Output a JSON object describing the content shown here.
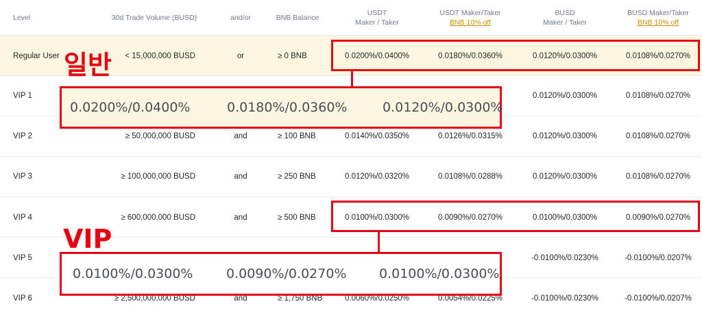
{
  "header": {
    "level": "Level",
    "volume": "30d Trade Volume (BUSD)",
    "andor": "and/or",
    "bnb": "BNB Balance",
    "usdt_line1": "USDT",
    "usdt_line2": "Maker / Taker",
    "usdt_disc_line1": "USDT Maker/Taker",
    "usdt_disc_line2": "BNB 10% off",
    "busd_line1": "BUSD",
    "busd_line2": "Maker / Taker",
    "busd_disc_line1": "BUSD Maker/Taker",
    "busd_disc_line2": "BNB 10% off"
  },
  "rows": [
    {
      "level": "Regular User",
      "volume": "< 15,000,000 BUSD",
      "andor": "or",
      "bnb": "≥ 0 BNB",
      "usdt": "0.0200%/0.0400%",
      "usdt_disc": "0.0180%/0.0360%",
      "busd": "0.0120%/0.0300%",
      "busd_disc": "0.0108%/0.0270%"
    },
    {
      "level": "VIP 1",
      "volume": "",
      "andor": "",
      "bnb": "",
      "usdt": "",
      "usdt_disc": "",
      "busd": "0.0120%/0.0300%",
      "busd_disc": "0.0108%/0.0270%"
    },
    {
      "level": "VIP 2",
      "volume": "≥ 50,000,000 BUSD",
      "andor": "and",
      "bnb": "≥ 100 BNB",
      "usdt": "0.0140%/0.0350%",
      "usdt_disc": "0.0126%/0.0315%",
      "busd": "0.0120%/0.0300%",
      "busd_disc": "0.0108%/0.0270%"
    },
    {
      "level": "VIP 3",
      "volume": "≥ 100,000,000 BUSD",
      "andor": "and",
      "bnb": "≥ 250 BNB",
      "usdt": "0.0120%/0.0320%",
      "usdt_disc": "0.0108%/0.0288%",
      "busd": "0.0120%/0.0300%",
      "busd_disc": "0.0108%/0.0270%"
    },
    {
      "level": "VIP 4",
      "volume": "≥ 600,000,000 BUSD",
      "andor": "and",
      "bnb": "≥ 500 BNB",
      "usdt": "0.0100%/0.0300%",
      "usdt_disc": "0.0090%/0.0270%",
      "busd": "0.0100%/0.0300%",
      "busd_disc": "0.0090%/0.0270%"
    },
    {
      "level": "VIP 5",
      "volume": "",
      "andor": "",
      "bnb": "",
      "usdt": "",
      "usdt_disc": "",
      "busd": "-0.0100%/0.0230%",
      "busd_disc": "-0.0100%/0.0207%"
    },
    {
      "level": "VIP 6",
      "volume": "≥ 2,500,000,000 BUSD",
      "andor": "and",
      "bnb": "≥ 1,750 BNB",
      "usdt": "0.0060%/0.0250%",
      "usdt_disc": "0.0054%/0.0225%",
      "busd": "-0.0100%/0.0230%",
      "busd_disc": "-0.0100%/0.0207%"
    }
  ],
  "annotations": {
    "regular_label": "일반",
    "vip_label": "VIP",
    "regular_zoom": [
      "0.0200%/0.0400%",
      "0.0180%/0.0360%",
      "0.0120%/0.0300%"
    ],
    "vip_zoom": [
      "0.0100%/0.0300%",
      "0.0090%/0.0270%",
      "0.0100%/0.0300%"
    ],
    "accent_color": "#e60012",
    "highlight_color": "#fdf6e1"
  }
}
